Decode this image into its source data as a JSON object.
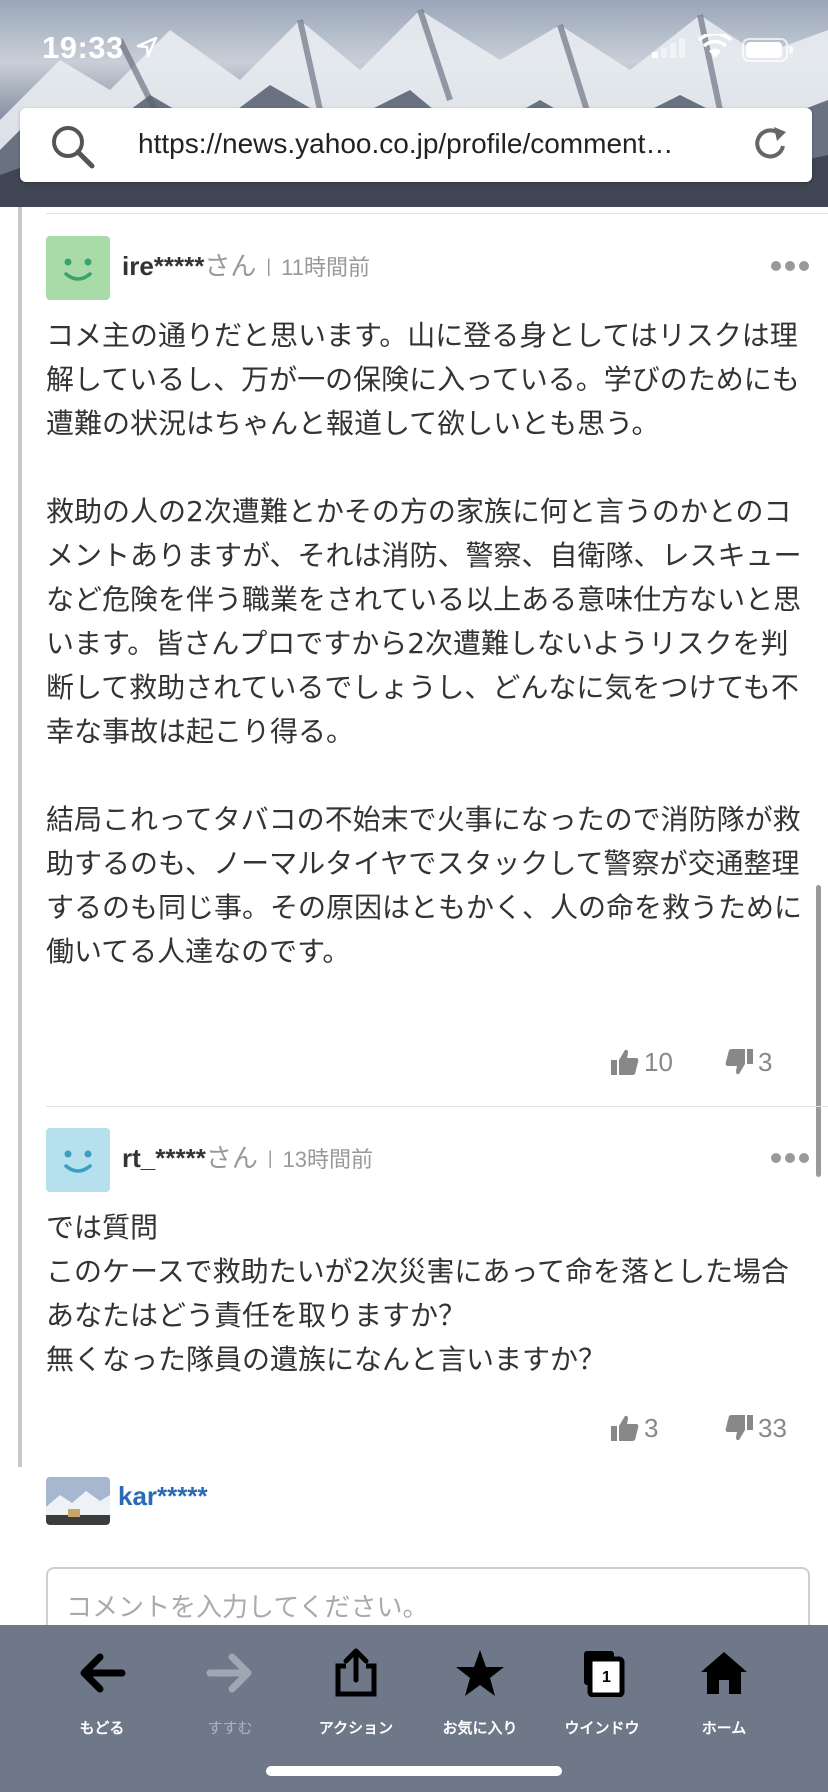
{
  "status_bar": {
    "time": "19:33"
  },
  "address_bar": {
    "url": "https://news.yahoo.co.jp/profile/comment…"
  },
  "comments": [
    {
      "user": "ire*****",
      "honorific": "さん",
      "separator": "|",
      "time_ago": "11時間前",
      "avatar_color": "#a8dba8",
      "text": "コメ主の通りだと思います。山に登る身としてはリスクは理解しているし、万が一の保険に入っている。学びのためにも遭難の状況はちゃんと報道して欲しいとも思う。\n\n救助の人の2次遭難とかその方の家族に何と言うのかとのコメントありますが、それは消防、警察、自衛隊、レスキューなど危険を伴う職業をされている以上ある意味仕方ないと思います。皆さんプロですから2次遭難しないようリスクを判断して救助されているでしょうし、どんなに気をつけても不幸な事故は起こり得る。\n\n結局これってタバコの不始末で火事になったので消防隊が救助するのも、ノーマルタイヤでスタックして警察が交通整理するのも同じ事。その原因はともかく、人の命を救うために働いてる人達なのです。",
      "likes": "10",
      "dislikes": "3"
    },
    {
      "user": "rt_*****",
      "honorific": "さん",
      "separator": "|",
      "time_ago": "13時間前",
      "avatar_color": "#b6e0ee",
      "text": "では質問\nこのケースで救助たいが2次災害にあって命を落とした場合あなたはどう責任を取りますか？\n無くなった隊員の遺族になんと言いますか？",
      "likes": "3",
      "dislikes": "33"
    }
  ],
  "reply_box": {
    "current_user": "kar*****",
    "placeholder": "コメントを入力してください。"
  },
  "toolbar": {
    "back": "もどる",
    "forward": "すすむ",
    "action": "アクション",
    "favorites": "お気に入り",
    "windows": "ウインドウ",
    "window_count": "1",
    "home": "ホーム"
  }
}
